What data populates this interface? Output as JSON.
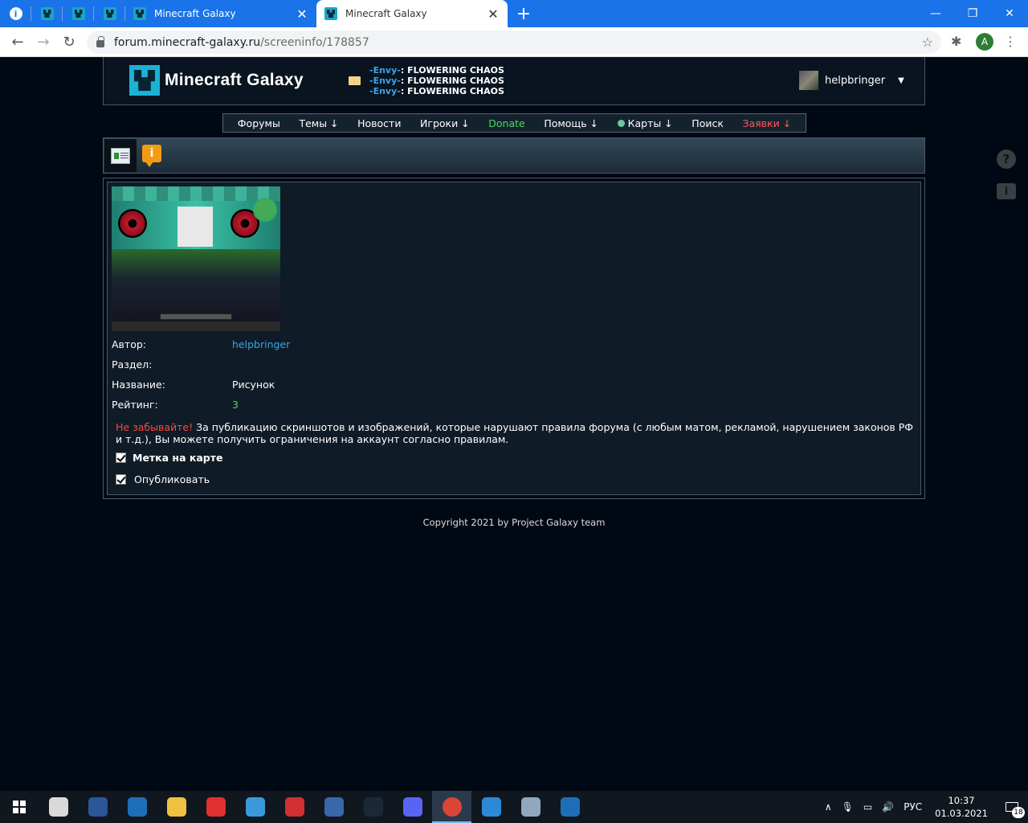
{
  "browser": {
    "tabs": [
      {
        "type": "pinned",
        "icon": "info-icon"
      },
      {
        "type": "pinned",
        "icon": "creeper-icon"
      },
      {
        "type": "pinned",
        "icon": "creeper-icon"
      },
      {
        "type": "pinned",
        "icon": "creeper-icon"
      },
      {
        "type": "normal",
        "title": "Minecraft Galaxy",
        "icon": "creeper-icon"
      },
      {
        "type": "active",
        "title": "Minecraft Galaxy",
        "icon": "creeper-icon"
      }
    ],
    "close_glyph": "✕",
    "new_tab_glyph": "+",
    "window_controls": {
      "minimize": "—",
      "restore": "❐",
      "close": "✕"
    },
    "url_host": "forum.minecraft-galaxy.ru",
    "url_path": "/screeninfo/178857",
    "profile_initial": "A",
    "star_glyph": "☆",
    "ext_glyph": "✱",
    "menu_glyph": "⋮"
  },
  "header": {
    "brand": "Minecraft Galaxy",
    "news": [
      {
        "who": "-Envy-",
        "sep": ":",
        "text": " FLOWERING CHAOS"
      },
      {
        "who": "-Envy-",
        "sep": ":",
        "text": " FLOWERING CHAOS"
      },
      {
        "who": "-Envy-",
        "sep": ":",
        "text": " FLOWERING CHAOS"
      }
    ],
    "username": "helpbringer",
    "user_menu_glyph": "▼"
  },
  "menu": {
    "forums": "Форумы",
    "topics": "Темы ↓",
    "news": "Новости",
    "players": "Игроки ↓",
    "donate": "Donate",
    "help": "Помощь ↓",
    "maps": "Карты ↓",
    "search": "Поиск",
    "requests": "Заявки ↓"
  },
  "toolbar": {
    "info_glyph": "i"
  },
  "screen": {
    "author_label": "Автор:",
    "author_value": "helpbringer",
    "section_label": "Раздел:",
    "section_value": "",
    "name_label": "Название:",
    "name_value": "Рисунок",
    "rating_label": "Рейтинг:",
    "rating_value": "3",
    "warning_head": "Не забывайте!",
    "warning_text": " За публикацию скриншотов и изображений, которые нарушают правила форума (с любым матом, рекламой, нарушением законов РФ и т.д.), Вы можете получить ограничения на аккаунт согласно правилам.",
    "map_mark_label": "Метка на карте",
    "publish_label": "Опубликовать"
  },
  "footer": {
    "copyright": "Copyright 2021 by Project Galaxy team"
  },
  "side": {
    "help_glyph": "?",
    "info_glyph": "i"
  },
  "taskbar": {
    "apps": [
      {
        "name": "app-1",
        "color": "#d9d9d9"
      },
      {
        "name": "word",
        "color": "#2b579a"
      },
      {
        "name": "app-3",
        "color": "#1e6fb8"
      },
      {
        "name": "explorer",
        "color": "#f0c040"
      },
      {
        "name": "app-5",
        "color": "#e03030"
      },
      {
        "name": "app-6",
        "color": "#3a9ad9"
      },
      {
        "name": "app-7",
        "color": "#d03030"
      },
      {
        "name": "app-8",
        "color": "#3a66aa"
      },
      {
        "name": "steam",
        "color": "#1b2838"
      },
      {
        "name": "discord",
        "color": "#5865f2"
      },
      {
        "name": "chrome",
        "color": "#db4437"
      },
      {
        "name": "app-12",
        "color": "#2a8ad8"
      },
      {
        "name": "app-13",
        "color": "#8fa8c0"
      },
      {
        "name": "app-14",
        "color": "#1e6fb8"
      }
    ],
    "lang": "РУС",
    "time": "10:37",
    "date": "01.03.2021",
    "notif_count": "18",
    "tray_up": "∧",
    "tray_mic": "🎙",
    "tray_net": "▭",
    "tray_vol": "🔊"
  }
}
